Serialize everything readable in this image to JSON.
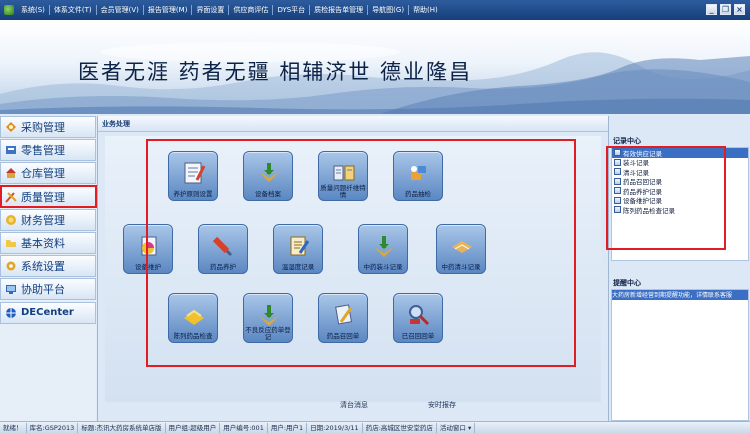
{
  "menubar": {
    "items": [
      "系统(S)",
      "体系文件(T)",
      "会员管理(V)",
      "报告管理(M)",
      "界面设置",
      "供应商评估",
      "DYS平台",
      "质检报告单管理",
      "导航图(G)",
      "帮助(H)"
    ],
    "window_controls": [
      "_",
      "❐",
      "×"
    ]
  },
  "banner": {
    "slogan": "医者无涯  药者无疆  相辅济世  德业隆昌"
  },
  "sidebar": {
    "items": [
      {
        "label": "采购管理",
        "icon": "purchase-icon"
      },
      {
        "label": "零售管理",
        "icon": "retail-icon"
      },
      {
        "label": "仓库管理",
        "icon": "warehouse-icon"
      },
      {
        "label": "质量管理",
        "icon": "quality-icon"
      },
      {
        "label": "财务管理",
        "icon": "finance-icon"
      },
      {
        "label": "基本资料",
        "icon": "basic-data-icon"
      },
      {
        "label": "系统设置",
        "icon": "settings-icon"
      },
      {
        "label": "协助平台",
        "icon": "assist-platform-icon"
      },
      {
        "label": "DECenter",
        "icon": "decenter-icon"
      }
    ]
  },
  "main": {
    "title": "业务处理",
    "tiles": [
      {
        "label": "养护原则设置",
        "icon": "maintenance-rule-icon"
      },
      {
        "label": "设备档案",
        "icon": "equipment-file-icon"
      },
      {
        "label": "质量问题纤维特情",
        "icon": "quality-issue-icon"
      },
      {
        "label": "药品抽检",
        "icon": "drug-inspection-icon"
      },
      {
        "label": "设备维护",
        "icon": "equipment-maintenance-icon"
      },
      {
        "label": "药品养护",
        "icon": "drug-care-icon"
      },
      {
        "label": "温湿度记录",
        "icon": "temperature-humidity-icon"
      },
      {
        "label": "中药装斗记录",
        "icon": "herb-fill-icon"
      },
      {
        "label": "中药清斗记录",
        "icon": "herb-clear-icon"
      },
      {
        "label": "陈列药品检查",
        "icon": "display-check-icon"
      },
      {
        "label": "不良反应药单登记",
        "icon": "adverse-reaction-icon"
      },
      {
        "label": "药品召回单",
        "icon": "recall-order-icon"
      },
      {
        "label": "已召回回单",
        "icon": "recalled-receipt-icon"
      }
    ],
    "bottom_links": [
      "清台消息",
      "安时报存"
    ]
  },
  "right_panel": {
    "records_title": "记录中心",
    "records": [
      "有效供应记录",
      "装斗记录",
      "清斗记录",
      "药品召回记录",
      "药品养护记录",
      "设备维护记录",
      "陈列药品检查记录"
    ],
    "reminder_title": "提醒中心",
    "reminder_text": "大药房新增经营到期提醒功能，详情联系客服"
  },
  "statusbar": {
    "cells": [
      "就绪！",
      "库名:GSP2013",
      "标题:杰讯大药房系统单店版",
      "用户组:超级用户",
      "用户编号:001",
      "用户:用户1",
      "日期:2019/3/11",
      "药店:高城区世安堂药店",
      "活动窗口 ▾"
    ]
  },
  "colors": {
    "menubar": "#1f4d8f",
    "accent_red": "#e21c23",
    "tile_blue": "#6e97cc",
    "selection": "#3b6fc4"
  }
}
